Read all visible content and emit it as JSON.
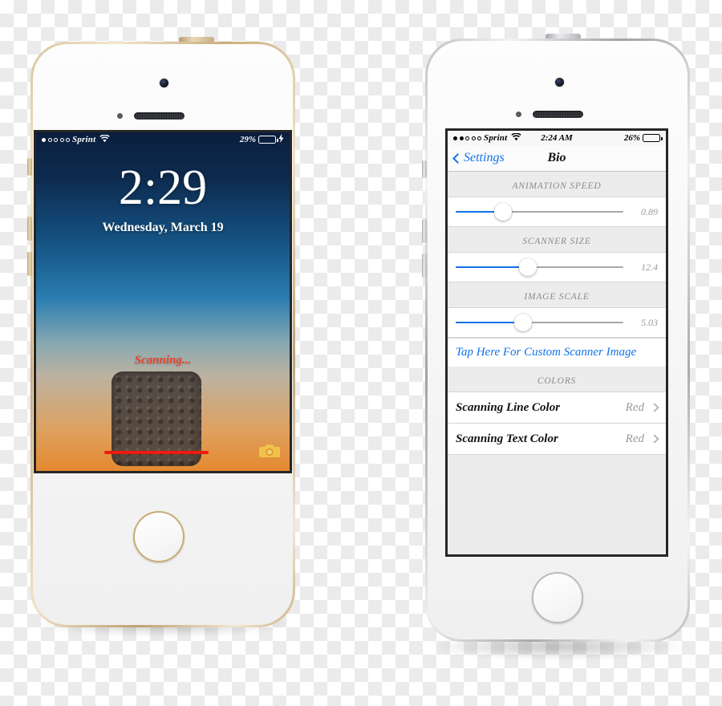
{
  "phones": [
    {
      "id": "lockscreen-phone",
      "frame_color": "#d8c49a",
      "frame_finish": "gold",
      "status_bar": {
        "signal_dots_filled": 1,
        "signal_dots_total": 5,
        "carrier": "Sprint",
        "wifi_icon": "wifi-icon",
        "battery_percent_label": "29%",
        "battery_level": 29,
        "battery_color": "#3ddc4a",
        "charging": true,
        "charging_icon": "lightning-bolt-icon"
      },
      "lockscreen": {
        "time": "2:29",
        "date": "Wednesday, March 19",
        "scanning_label": "Scanning...",
        "scanning_label_color": "#e8452f",
        "scan_line_color": "#ee1b12",
        "scanner_pad_name": "fingerprint-scanner-pad",
        "camera_icon": "camera-icon",
        "camera_icon_color": "#f0c24a",
        "wallpaper_top_color": "#0a1e3d",
        "wallpaper_mid_color": "#2a7cb0",
        "wallpaper_bottom_color": "#e5892f"
      }
    },
    {
      "id": "settings-phone",
      "frame_color": "#bcbec0",
      "frame_finish": "silver",
      "status_bar": {
        "signal_dots_filled": 2,
        "signal_dots_total": 5,
        "carrier": "Sprint",
        "wifi_icon": "wifi-icon",
        "time": "2:24 AM",
        "battery_percent_label": "26%",
        "battery_level": 26,
        "battery_color": "#000000",
        "charging": false
      },
      "navbar": {
        "back_label": "Settings",
        "back_icon": "chevron-left-icon",
        "title": "Bio",
        "accent_color": "#1272e8"
      },
      "sections": [
        {
          "header": "ANIMATION SPEED",
          "type": "slider",
          "value_label": "0.89",
          "fill_percent": 28
        },
        {
          "header": "SCANNER SIZE",
          "type": "slider",
          "value_label": "12.4",
          "fill_percent": 43
        },
        {
          "header": "IMAGE SCALE",
          "type": "slider",
          "value_label": "5.03",
          "fill_percent": 40
        }
      ],
      "custom_image_link": "Tap Here For Custom Scanner Image",
      "colors_section": {
        "header": "COLORS",
        "rows": [
          {
            "label": "Scanning Line Color",
            "value": "Red",
            "chevron": "chevron-right-icon"
          },
          {
            "label": "Scanning Text Color",
            "value": "Red",
            "chevron": "chevron-right-icon"
          }
        ]
      }
    }
  ]
}
